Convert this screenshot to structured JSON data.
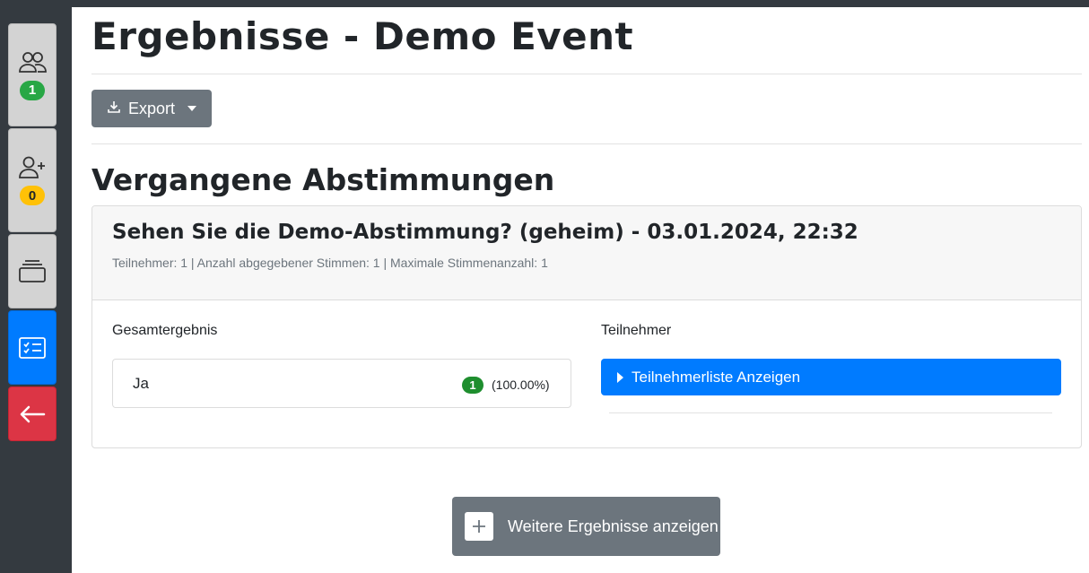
{
  "page": {
    "title": "Ergebnisse - Demo Event",
    "export_label": "Export",
    "section_title": "Vergangene Abstimmungen",
    "more_label": "Weitere Ergebnisse anzeigen"
  },
  "sidebar": {
    "items": [
      {
        "icon": "users-icon",
        "badge": "1",
        "badge_color": "#28a745"
      },
      {
        "icon": "add-user-icon",
        "badge": "0",
        "badge_color": "#ffc107"
      },
      {
        "icon": "stack-icon"
      },
      {
        "icon": "checklist-icon",
        "active": true
      },
      {
        "icon": "arrow-left-icon"
      }
    ]
  },
  "poll": {
    "title": "Sehen Sie die Demo-Abstimmung? (geheim) - 03.01.2024, 22:32",
    "stats": "Teilnehmer: 1 | Anzahl abgegebener Stimmen: 1 | Maximale Stimmenanzahl: 1",
    "result_heading": "Gesamtergebnis",
    "participants_heading": "Teilnehmer",
    "participants_button": "Teilnehmerliste Anzeigen",
    "results": [
      {
        "label": "Ja",
        "count": "1",
        "percent": "(100.00%)"
      }
    ]
  },
  "colors": {
    "primary": "#007bff",
    "secondary": "#6c757d",
    "danger": "#dc3545",
    "success": "#28a745",
    "warning": "#ffc107",
    "dark": "#343a40"
  }
}
